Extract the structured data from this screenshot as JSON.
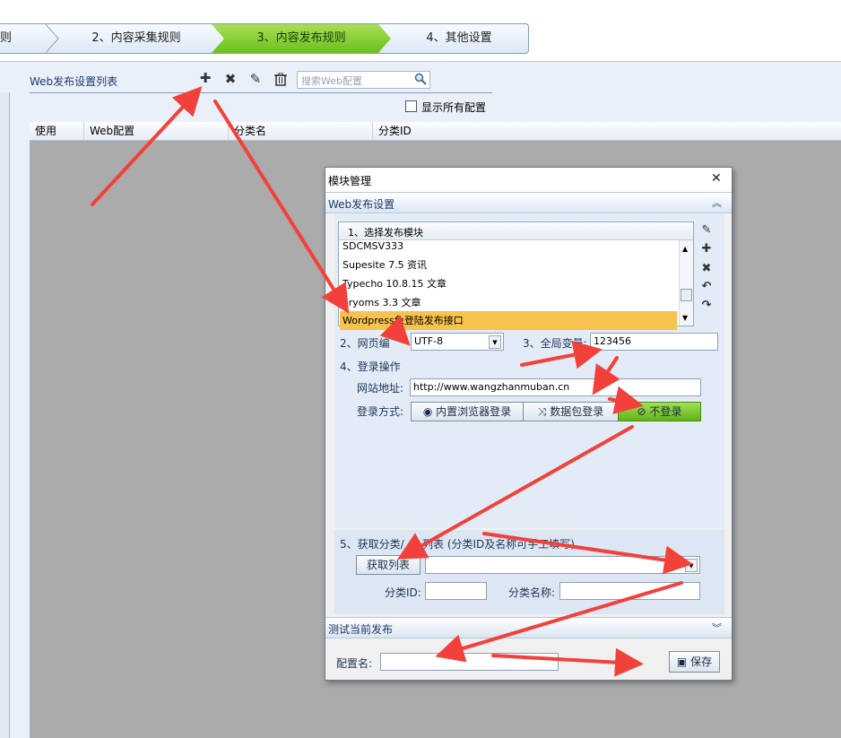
{
  "wizard": {
    "steps": [
      {
        "label": "则"
      },
      {
        "label": "2、内容采集规则"
      },
      {
        "label": "3、内容发布规则"
      },
      {
        "label": "4、其他设置"
      }
    ],
    "active_color": "#7ccb2b"
  },
  "panel": {
    "title": "Web发布设置列表",
    "search_placeholder": "搜索Web配置",
    "show_all_label": "显示所有配置",
    "columns": [
      "使用",
      "Web配置",
      "分类名",
      "分类ID"
    ],
    "toolbar_icons": [
      "plus-icon",
      "close-icon",
      "pencil-icon",
      "trash-icon",
      "search-icon"
    ]
  },
  "dialog": {
    "title": "模块管理",
    "close_glyph": "✕",
    "section1_title": "Web发布设置",
    "collapse_glyph": "︽",
    "expand_glyph": "︾",
    "step1_label": "1、选择发布模块",
    "modules": [
      "SDCMSV333",
      "Supesite 7.5 资讯",
      "Typecho 10.8.15 文章",
      "eryoms 3.3 文章",
      "Wordpress免登陆发布接口"
    ],
    "selected_module_index": 4,
    "selected_color": "#f7c24d",
    "step2_label": "2、网页编",
    "encoding": "UTF-8",
    "step3_label": "3、全局变量:",
    "global_var": "123456",
    "step4_label": "4、登录操作",
    "site_url_label": "网站地址:",
    "site_url": "http://www.wangzhanmuban.cn",
    "login_method_label": "登录方式:",
    "login_buttons": [
      "内置浏览器登录",
      "数据包登录",
      "不登录"
    ],
    "login_active_index": 2,
    "step5_label": "5、获取分类/",
    "step5_label_tail": "列表 (分类ID及名称可手工填写)",
    "fetch_list_button": "获取列表",
    "category_select": "",
    "category_id_label": "分类ID:",
    "category_id": "",
    "category_name_label": "分类名称:",
    "category_name": "",
    "test_section_title": "测试当前发布",
    "config_name_label": "配置名:",
    "config_name": "",
    "save_button": "保存"
  }
}
